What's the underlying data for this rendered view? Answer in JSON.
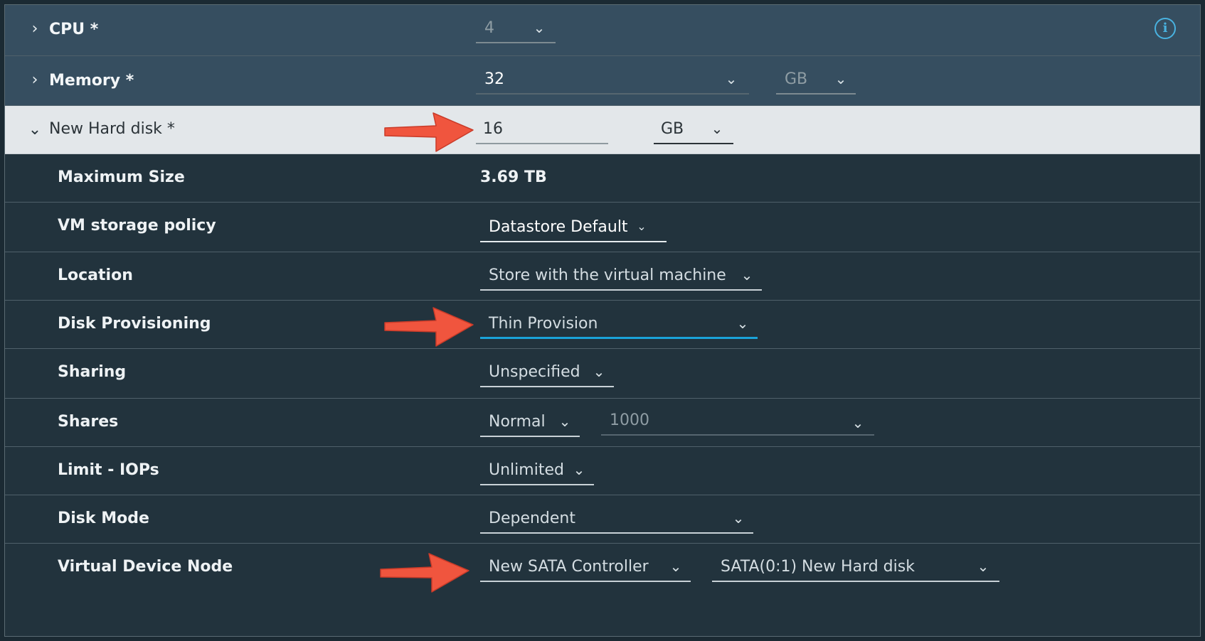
{
  "colors": {
    "header_row": "#364e60",
    "selected_row": "#e3e7ea",
    "body_rows": "#22333d",
    "active_underline": "#1aa3d9",
    "annotation_arrow": "#f0553e"
  },
  "icons": {
    "collapsed": "chevron-right-icon",
    "expanded": "chevron-down-icon",
    "dropdown": "chevron-down-icon",
    "info": "info-icon",
    "annotation": "red-arrow-annotation"
  },
  "cpu": {
    "label": "CPU *",
    "value": "4",
    "info_glyph": "i"
  },
  "memory": {
    "label": "Memory *",
    "value": "32",
    "unit": "GB"
  },
  "new_hard_disk": {
    "label": "New Hard disk *",
    "size_value": "16",
    "size_unit": "GB",
    "maximum_size": {
      "label": "Maximum Size",
      "value": "3.69 TB"
    },
    "vm_storage_policy": {
      "label": "VM storage policy",
      "value": "Datastore Default"
    },
    "location": {
      "label": "Location",
      "value": "Store with the virtual machine"
    },
    "disk_provisioning": {
      "label": "Disk Provisioning",
      "value": "Thin Provision"
    },
    "sharing": {
      "label": "Sharing",
      "value": "Unspecified"
    },
    "shares": {
      "label": "Shares",
      "level": "Normal",
      "value": "1000"
    },
    "limit_iops": {
      "label": "Limit - IOPs",
      "value": "Unlimited"
    },
    "disk_mode": {
      "label": "Disk Mode",
      "value": "Dependent"
    },
    "virtual_device_node": {
      "label": "Virtual Device Node",
      "controller": "New SATA Controller",
      "node": "SATA(0:1) New Hard disk"
    }
  }
}
